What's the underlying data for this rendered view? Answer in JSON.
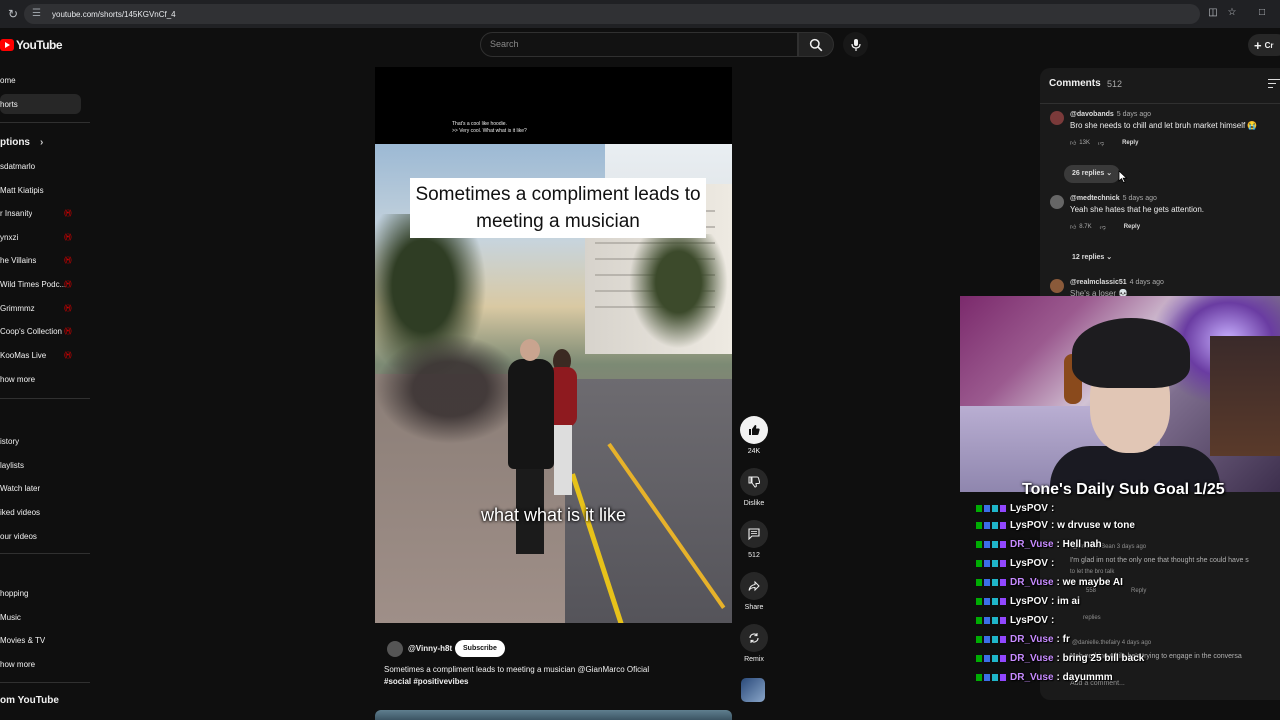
{
  "browser": {
    "url": "youtube.com/shorts/145KGVnCf_4"
  },
  "header": {
    "logo_text": "YouTube",
    "search_placeholder": "Search",
    "create_label": "Cr"
  },
  "sidebar": {
    "top": [
      {
        "label": "Home",
        "display": "ome"
      },
      {
        "label": "Shorts",
        "display": "horts"
      }
    ],
    "subscriptions_heading": "ptions",
    "subscriptions": [
      {
        "display": "sdatmarlo",
        "live": false
      },
      {
        "display": "Matt Kiatipis",
        "live": false
      },
      {
        "display": "r Insanity",
        "live": true
      },
      {
        "display": "ynxzi",
        "live": true
      },
      {
        "display": "he Villains",
        "live": true
      },
      {
        "display": "Wild Times Podc...",
        "live": true
      },
      {
        "display": "Grimmmz",
        "live": true
      },
      {
        "display": "Coop's Collection",
        "live": true
      },
      {
        "display": "KooMas Live",
        "live": true
      },
      {
        "display": "how more",
        "live": false
      }
    ],
    "you": [
      {
        "display": "istory"
      },
      {
        "display": "laylists"
      },
      {
        "display": "Watch later"
      },
      {
        "display": "iked videos"
      },
      {
        "display": "our videos"
      }
    ],
    "explore": [
      {
        "display": "hopping"
      },
      {
        "display": "Music"
      },
      {
        "display": "Movies & TV"
      },
      {
        "display": "how more"
      }
    ],
    "more_heading": "om YouTube"
  },
  "short": {
    "top_caption_line1": "That's a cool like hoodie.",
    "top_caption_line2": ">> Very cool. What what is it like?",
    "title_overlay": "Sometimes a compliment leads to meeting a musician",
    "subtitle": "what what is it like",
    "channel": "@Vinny-h8t",
    "subscribe_label": "Subscribe",
    "description": "Sometimes a compliment leads to meeting a musician @GianMarco Oficial",
    "hashtags": "#social #positivevibes"
  },
  "actions": {
    "like_count": "24K",
    "dislike_label": "Dislike",
    "comments_count": "512",
    "share_label": "Share",
    "remix_label": "Remix"
  },
  "comments": {
    "title": "Comments",
    "count": "512",
    "items": [
      {
        "author": "@davobands",
        "time": "5 days ago",
        "text": "Bro she needs to chill and let bruh market himself 😭",
        "likes": "13K",
        "reply_label": "Reply",
        "replies": "26 replies"
      },
      {
        "author": "@medtechnick",
        "time": "5 days ago",
        "text": "Yeah she hates that he gets attention.",
        "likes": "8.7K",
        "reply_label": "Reply",
        "replies": "12 replies"
      },
      {
        "author": "@realmclassic51",
        "time": "4 days ago",
        "text": "She's a loser 💀"
      }
    ],
    "add_placeholder": "Add a comment..."
  },
  "stream_overlay": {
    "goal_text": "Tone's Daily Sub Goal 1/25",
    "chat": [
      {
        "user": "LysPOV",
        "msg": ":",
        "color": "#f7f7f7"
      },
      {
        "user": "LysPOV",
        "msg": ": w drvuse w tone",
        "color": "#f7f7f7"
      },
      {
        "user": "DR_Vuse",
        "msg": ": Hell nah",
        "color": "#c78bff"
      },
      {
        "user": "LysPOV",
        "msg": ":",
        "color": "#f7f7f7"
      },
      {
        "user": "DR_Vuse",
        "msg": ": we maybe AI",
        "color": "#c78bff"
      },
      {
        "user": "LysPOV",
        "msg": ": im ai",
        "color": "#f7f7f7"
      },
      {
        "user": "LysPOV",
        "msg": ":",
        "color": "#f7f7f7"
      },
      {
        "user": "DR_Vuse",
        "msg": ": fr",
        "color": "#c78bff"
      },
      {
        "user": "DR_Vuse",
        "msg": ": bring 25 bill back",
        "color": "#c78bff"
      },
      {
        "user": "DR_Vuse",
        "msg": ": dayummm",
        "color": "#c78bff"
      }
    ],
    "background_comment_fragments": [
      "@BrandMrBean 3 days ago",
      "I'm glad im not the only one that thought she could have s",
      "to let the bro talk",
      "558",
      "Reply",
      "replies",
      "@danielle.thefairy 4 days ago",
      "Nah nothing while he's trying to engage in the conversa"
    ]
  },
  "colors": {
    "youtube_red": "#ff0000",
    "background": "#0f0f0f",
    "live_dot": "#cc0000"
  }
}
